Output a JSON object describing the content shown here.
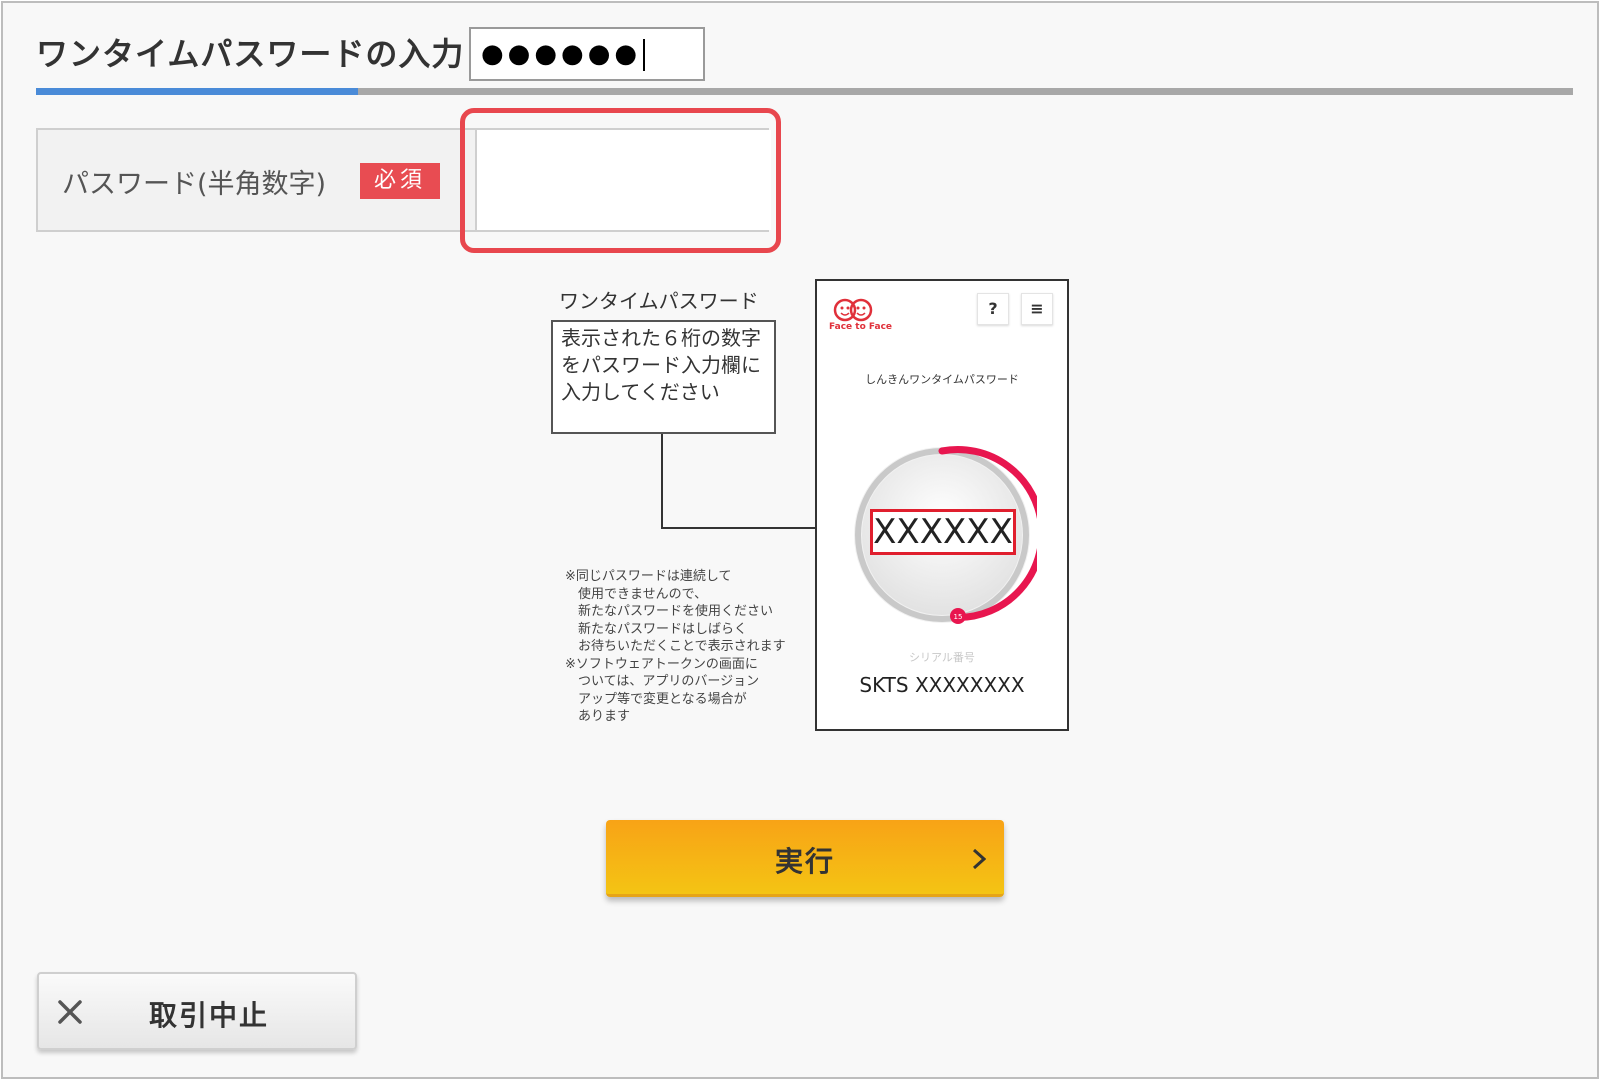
{
  "header": {
    "title": "ワンタイムパスワードの入力"
  },
  "form": {
    "label": "パスワード(半角数字)",
    "required_badge": "必須",
    "password_value": "●●●●●●"
  },
  "illustration": {
    "caption": "ワンタイムパスワード",
    "instruction_lines": [
      "表示された６桁の数字",
      "をパスワード入力欄に",
      "入力してください"
    ],
    "notes_lines": [
      "※同じパスワードは連続して",
      "　使用できませんので、",
      "　新たなパスワードを使用ください",
      "　新たなパスワードはしばらく",
      "　お待ちいただくことで表示されます",
      "※ソフトウェアトークンの画面に",
      "　ついては、アプリのバージョン",
      "　アップ等で変更となる場合が",
      "　あります"
    ],
    "phone": {
      "logo_text": "Face to Face",
      "help_icon": "?",
      "menu_icon": "≡",
      "app_title": "しんきんワンタイムパスワード",
      "code": "XXXXXX",
      "timer": "15",
      "serial_caption": "シリアル番号",
      "serial_number": "SKTS XXXXXXXX"
    }
  },
  "actions": {
    "execute_label": "実行",
    "cancel_label": "取引中止"
  },
  "colors": {
    "accent_blue": "#4a8bd8",
    "required_red": "#e84c52",
    "highlight_red": "#e8474e",
    "button_orange": "#f8a316",
    "ring_red": "#e8164f"
  }
}
